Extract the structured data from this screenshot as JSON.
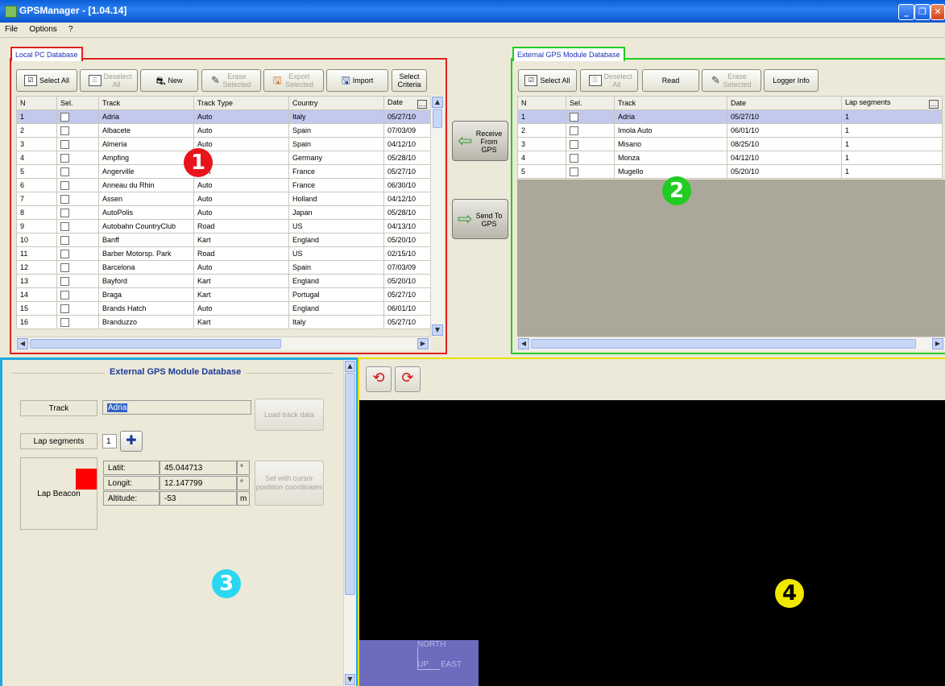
{
  "window": {
    "title": "GPSManager - [1.04.14]"
  },
  "menu": [
    "File",
    "Options",
    "?"
  ],
  "local_db": {
    "tab_label": "Local PC Database",
    "toolbar": {
      "select_all": "Select All",
      "deselect": "Deselect All",
      "new": "New",
      "erase": "Erase Selected",
      "export": "Export Selected",
      "import": "Import",
      "select_criteria": "Select Criteria"
    },
    "columns": [
      "N",
      "Sel.",
      "Track",
      "Track Type",
      "Country",
      "Date"
    ],
    "rows": [
      [
        "1",
        "",
        "Adria",
        "Auto",
        "Italy",
        "05/27/10"
      ],
      [
        "2",
        "",
        "Albacete",
        "Auto",
        "Spain",
        "07/03/09"
      ],
      [
        "3",
        "",
        "Almeria",
        "Auto",
        "Spain",
        "04/12/10"
      ],
      [
        "4",
        "",
        "Ampfing",
        "Kart",
        "Germany",
        "05/28/10"
      ],
      [
        "5",
        "",
        "Angerville",
        "Kart",
        "France",
        "05/27/10"
      ],
      [
        "6",
        "",
        "Anneau du Rhin",
        "Auto",
        "France",
        "06/30/10"
      ],
      [
        "7",
        "",
        "Assen",
        "Auto",
        "Holland",
        "04/12/10"
      ],
      [
        "8",
        "",
        "AutoPolis",
        "Auto",
        "Japan",
        "05/28/10"
      ],
      [
        "9",
        "",
        "Autobahn CountryClub",
        "Road",
        "US",
        "04/13/10"
      ],
      [
        "10",
        "",
        "Banff",
        "Kart",
        "England",
        "05/20/10"
      ],
      [
        "11",
        "",
        "Barber Motorsp. Park",
        "Road",
        "US",
        "02/15/10"
      ],
      [
        "12",
        "",
        "Barcelona",
        "Auto",
        "Spain",
        "07/03/09"
      ],
      [
        "13",
        "",
        "Bayford",
        "Kart",
        "England",
        "05/20/10"
      ],
      [
        "14",
        "",
        "Braga",
        "Kart",
        "Portugal",
        "05/27/10"
      ],
      [
        "15",
        "",
        "Brands Hatch",
        "Auto",
        "England",
        "06/01/10"
      ],
      [
        "16",
        "",
        "Branduzzo",
        "Kart",
        "Italy",
        "05/27/10"
      ]
    ]
  },
  "transfer": {
    "receive": "Receive From GPS",
    "send": "Send To GPS"
  },
  "external_db": {
    "tab_label": "External GPS Module Database",
    "toolbar": {
      "select_all": "Select All",
      "deselect": "Deselect All",
      "read": "Read",
      "erase": "Erase Selected",
      "logger_info": "Logger Info"
    },
    "columns": [
      "N",
      "Sel.",
      "Track",
      "Date",
      "Lap segments"
    ],
    "rows": [
      [
        "1",
        "",
        "Adria",
        "05/27/10",
        "1"
      ],
      [
        "2",
        "",
        "Imola Auto",
        "06/01/10",
        "1"
      ],
      [
        "3",
        "",
        "Misano",
        "08/25/10",
        "1"
      ],
      [
        "4",
        "",
        "Monza",
        "04/12/10",
        "1"
      ],
      [
        "5",
        "",
        "Mugello",
        "05/20/10",
        "1"
      ]
    ]
  },
  "detail": {
    "title": "External GPS Module Database",
    "track_label": "Track",
    "track_value": "Adria",
    "load_track_button": "Load track data",
    "lap_segments_label": "Lap segments",
    "lap_segments_value": "1",
    "lap_beacon_label": "Lap Beacon",
    "lap_beacon_color": "#ff0000",
    "latit_label": "Latit:",
    "latit_value": "45.044713",
    "latit_unit": "°",
    "longit_label": "Longit:",
    "longit_value": "12.147799",
    "longit_unit": "°",
    "altitude_label": "Altitude:",
    "altitude_value": "-53",
    "altitude_unit": "m",
    "set_cursor_button": "Set with cursor postition coordinates"
  },
  "map": {
    "north": "NORTH",
    "up": "UP",
    "east": "EAST"
  },
  "markers": {
    "m1": "1",
    "m2": "2",
    "m3": "3",
    "m4": "4"
  },
  "colors": {
    "panel1_border": "#e02020",
    "panel2_border": "#22cc22",
    "panel3_border": "#1fa8e0",
    "panel4_border": "#e8e000",
    "selected_row": "#c3c9ec"
  }
}
